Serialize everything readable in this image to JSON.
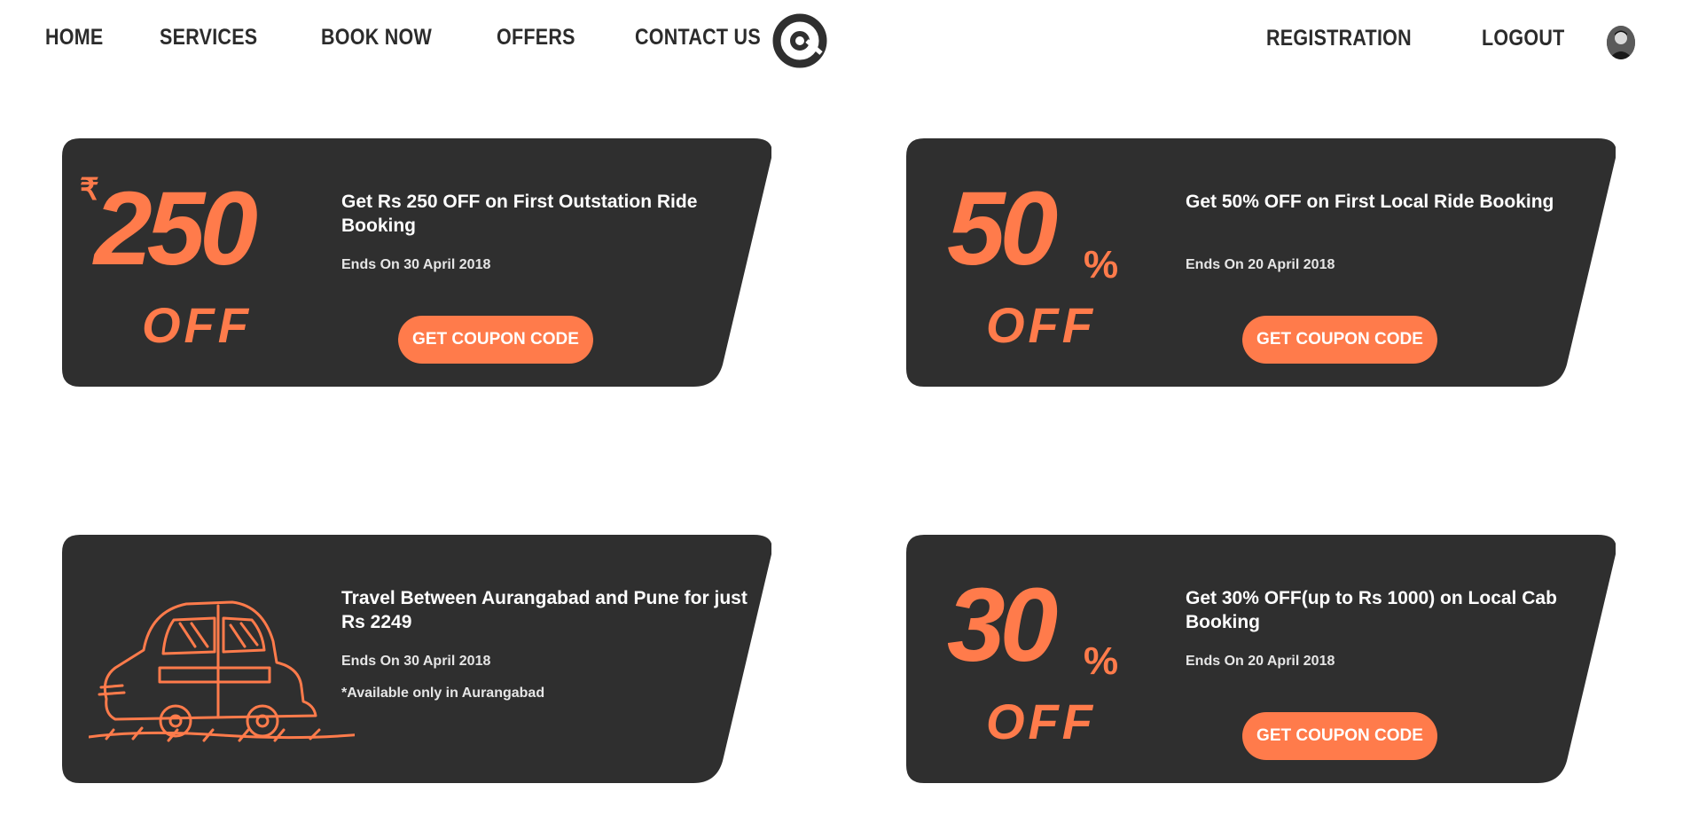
{
  "nav": {
    "left": [
      "HOME",
      "SERVICES",
      "BOOK NOW",
      "OFFERS",
      "CONTACT US"
    ],
    "right": [
      "REGISTRATION",
      "LOGOUT"
    ]
  },
  "colors": {
    "accent": "#ff7b4b",
    "card": "#2f2f2f",
    "nav_text": "#2b2b2b"
  },
  "offers": [
    {
      "graphic": {
        "symbol": "₹",
        "number": "250",
        "off": "OFF"
      },
      "title": "Get Rs 250 OFF on First Outstation Ride Booking",
      "ends": "Ends On 30 April 2018",
      "button": "GET COUPON CODE"
    },
    {
      "graphic": {
        "number": "50",
        "symbol": "%",
        "off": "OFF"
      },
      "title": "Get 50% OFF on First Local Ride Booking",
      "ends": "Ends On 20 April 2018",
      "button": "GET COUPON CODE"
    },
    {
      "graphic": {
        "icon": "car-sketch-icon"
      },
      "title": "Travel Between Aurangabad and Pune for just Rs 2249",
      "ends": "Ends On 30 April 2018",
      "note": "*Available only in Aurangabad"
    },
    {
      "graphic": {
        "number": "30",
        "symbol": "%",
        "off": "OFF"
      },
      "title": "Get 30% OFF(up to Rs 1000) on Local Cab Booking",
      "ends": "Ends On 20 April 2018",
      "button": "GET COUPON CODE"
    }
  ]
}
